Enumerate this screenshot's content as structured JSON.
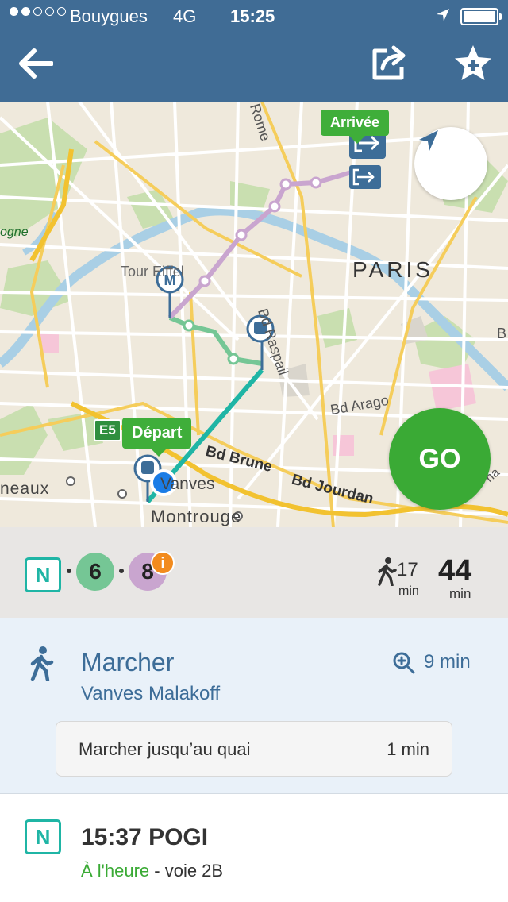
{
  "status_bar": {
    "carrier": "Bouygues",
    "network": "4G",
    "time": "15:25",
    "signal_bars_full": 2,
    "signal_bars_total": 5
  },
  "nav": {
    "back_icon": "back-arrow-icon",
    "share_icon": "share-icon",
    "favorite_icon": "star-plus-icon"
  },
  "map": {
    "labels": {
      "paris": "PARIS",
      "montrouge": "Montrouge",
      "bd_arago": "Bd Arago",
      "bd_brune": "Bd Brune",
      "bd_jourdan": "Bd Jourdan",
      "bd_raspail": "Bd Raspail",
      "rome": "Rome",
      "tour": "Tour Eiffel",
      "neaux": "neaux",
      "ogne": "ogne",
      "vanves": "Vanves",
      "b": "B",
      "na": "na"
    },
    "tag_depart": "Départ",
    "tag_arrivee": "Arrivée",
    "highway": "E5",
    "go_label": "GO",
    "colors": {
      "route_walk": "#1fb5a5",
      "line_6": "#75c695",
      "line_8": "#c9a5cf",
      "go": "#3aaa35"
    }
  },
  "summary": {
    "rer_badge": "N",
    "line_6": "6",
    "line_8": "8",
    "info_badge": "i",
    "walk_minutes": "17",
    "walk_unit": "min",
    "total_minutes": "44",
    "total_unit": "min"
  },
  "walk_step": {
    "title": "Marcher",
    "subtitle": "Vanves Malakoff",
    "duration": "9 min",
    "card_label": "Marcher jusqu’au quai",
    "card_duration": "1 min"
  },
  "train_step": {
    "badge": "N",
    "title": "15:37 POGI",
    "status": "À l'heure",
    "platform": " - voie 2B"
  }
}
